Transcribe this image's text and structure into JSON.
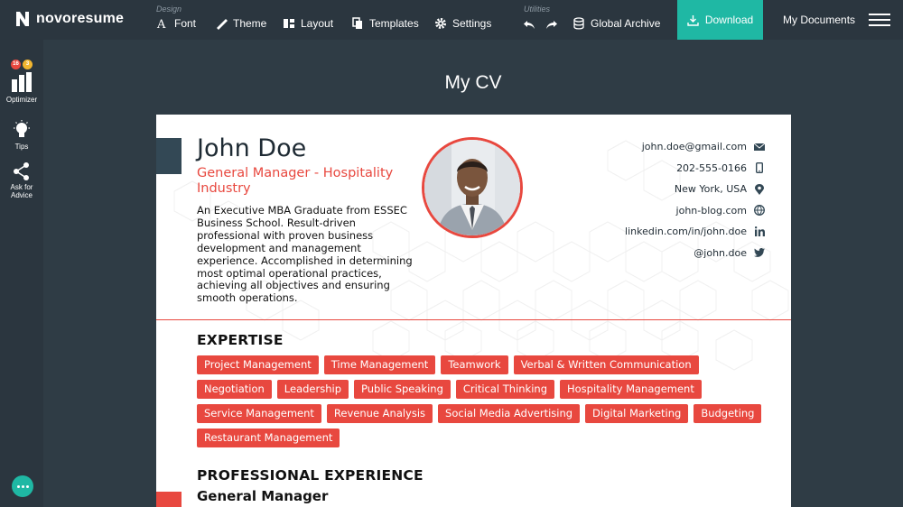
{
  "brand": {
    "name": "novoresume"
  },
  "toolbar": {
    "design_label": "Design",
    "utilities_label": "Utilities",
    "font": "Font",
    "theme": "Theme",
    "layout": "Layout",
    "templates": "Templates",
    "settings": "Settings",
    "global_archive": "Global Archive",
    "download": "Download",
    "my_documents": "My Documents"
  },
  "sidebar": {
    "optimizer": {
      "label": "Optimizer",
      "badge_red": "16",
      "badge_yellow": "3"
    },
    "tips": "Tips",
    "advice": "Ask for Advice"
  },
  "document_title": "My CV",
  "cv": {
    "name": "John Doe",
    "role": "General Manager - Hospitality Industry",
    "summary": "An Executive MBA Graduate from ESSEC Business School. Result-driven professional with proven business development and management experience. Accomplished in determining most optimal operational practices, achieving all objectives and ensuring smooth operations.",
    "contacts": [
      {
        "text": "john.doe@gmail.com",
        "icon": "envelope-icon"
      },
      {
        "text": "202-555-0166",
        "icon": "phone-icon"
      },
      {
        "text": "New York, USA",
        "icon": "location-pin-icon"
      },
      {
        "text": "john-blog.com",
        "icon": "globe-icon"
      },
      {
        "text": "linkedin.com/in/john.doe",
        "icon": "linkedin-icon"
      },
      {
        "text": "@john.doe",
        "icon": "twitter-icon"
      }
    ],
    "expertise_title": "EXPERTISE",
    "expertise": [
      "Project Management",
      "Time Management",
      "Teamwork",
      "Verbal & Written Communication",
      "Negotiation",
      "Leadership",
      "Public Speaking",
      "Critical Thinking",
      "Hospitality Management",
      "Service Management",
      "Revenue Analysis",
      "Social Media Advertising",
      "Digital Marketing",
      "Budgeting",
      "Restaurant Management"
    ],
    "experience_title": "PROFESSIONAL EXPERIENCE",
    "job_title": "General Manager"
  },
  "colors": {
    "accent": "#e8483f",
    "teal": "#1fb8a4",
    "background": "#2f3c45",
    "topbar": "#2b363f"
  }
}
